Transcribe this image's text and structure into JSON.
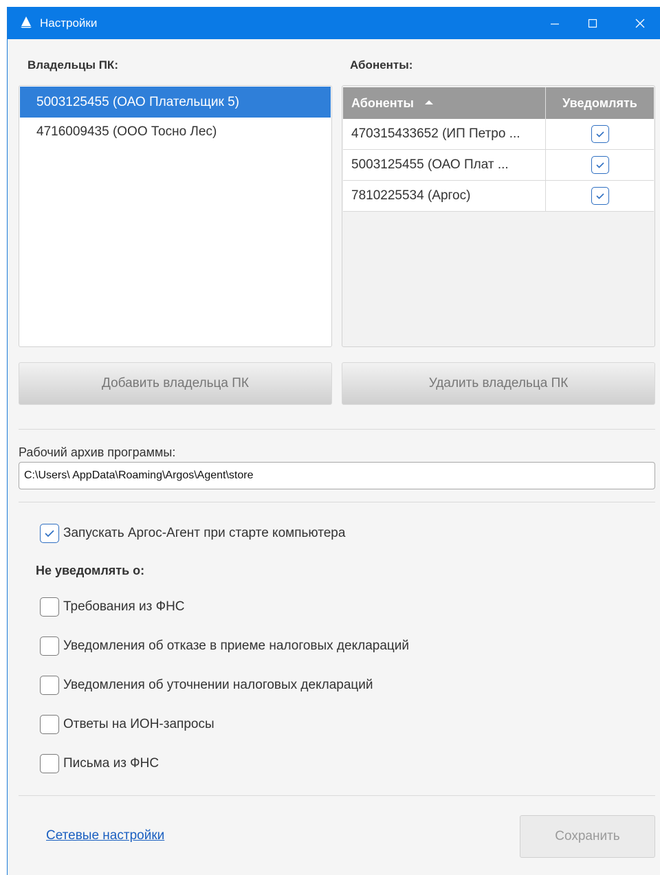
{
  "window": {
    "title": "Настройки"
  },
  "owners": {
    "label": "Владельцы ПК:",
    "items": [
      "5003125455 (ОАО Плательщик 5)",
      "4716009435 (ООО Тосно Лес)"
    ],
    "selected_index": 0
  },
  "subscribers": {
    "label": "Абоненты:",
    "columns": [
      "Абоненты",
      "Уведомлять"
    ],
    "rows": [
      {
        "name": "470315433652 (ИП Петро ...",
        "notify": true
      },
      {
        "name": "5003125455 (ОАО Плат ...",
        "notify": true
      },
      {
        "name": "7810225534 (Аргос)",
        "notify": true
      }
    ]
  },
  "buttons": {
    "add_owner": "Добавить владельца ПК",
    "remove_owner": "Удалить владельца ПК",
    "save": "Сохранить"
  },
  "archive": {
    "label": "Рабочий архив программы:",
    "value": "C:\\Users\\ AppData\\Roaming\\Argos\\Agent\\store"
  },
  "autostart": {
    "label": "Запускать Аргос-Агент при старте компьютера",
    "checked": true
  },
  "no_notify": {
    "title": "Не уведомлять о:",
    "options": [
      {
        "label": "Требования из ФНС",
        "checked": false
      },
      {
        "label": "Уведомления об отказе в приеме налоговых деклараций",
        "checked": false
      },
      {
        "label": "Уведомления об уточнении налоговых деклараций",
        "checked": false
      },
      {
        "label": "Ответы на ИОН-запросы",
        "checked": false
      },
      {
        "label": "Письма из ФНС",
        "checked": false
      }
    ]
  },
  "network_link": "Сетевые настройки",
  "colors": {
    "titlebar": "#0a7ae6",
    "selection": "#2f7fd9",
    "link": "#1a5fc0",
    "table_header": "#9a9a9a"
  }
}
